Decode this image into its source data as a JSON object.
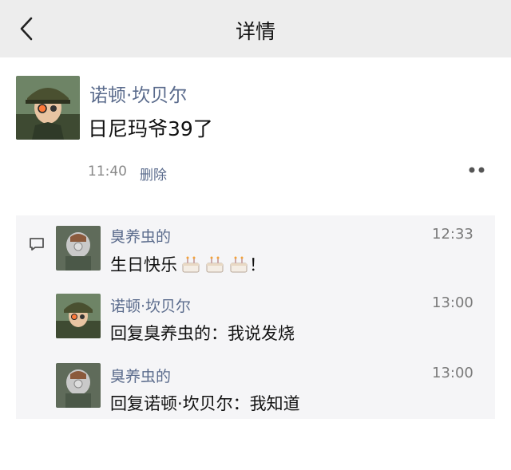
{
  "header": {
    "title": "详情",
    "back_icon": "chevron-left-icon"
  },
  "post": {
    "author": "诺顿·坎贝尔",
    "text": "日尼玛爷39了",
    "time": "11:40",
    "delete_label": "删除",
    "more_icon": "more-dots-icon"
  },
  "comments": [
    {
      "author": "臭养虫的",
      "time": "12:33",
      "text": "生日快乐",
      "emoji": "cake-emoji",
      "emoji_count": 3,
      "suffix": "！"
    },
    {
      "author": "诺顿·坎贝尔",
      "time": "13:00",
      "text": "回复臭养虫的：我说发烧"
    },
    {
      "author": "臭养虫的",
      "time": "13:00",
      "text": "回复诺顿·坎贝尔：我知道"
    }
  ],
  "colors": {
    "topbar": "#ededed",
    "name": "#5a6b8c",
    "panel": "#f5f5f7"
  }
}
